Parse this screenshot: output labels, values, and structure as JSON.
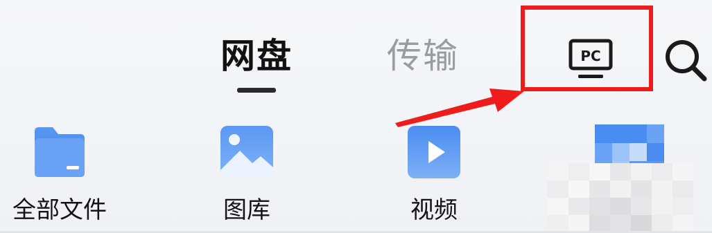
{
  "tabs": [
    {
      "label": "网盘",
      "active": true
    },
    {
      "label": "传输",
      "active": false
    }
  ],
  "toolbar": {
    "pc_icon_text": "PC",
    "pc_icon": "pc-monitor-icon",
    "search_icon": "search-icon"
  },
  "categories": [
    {
      "label": "全部文件",
      "icon": "folder-icon"
    },
    {
      "label": "图库",
      "icon": "image-icon"
    },
    {
      "label": "视频",
      "icon": "video-play-icon"
    },
    {
      "label": "",
      "icon": "document-icon"
    }
  ],
  "colors": {
    "accent_blue": "#4a8cf0",
    "annotation_red": "#ef1c1c",
    "active_text": "#111111",
    "inactive_text": "#9a9ca2"
  }
}
